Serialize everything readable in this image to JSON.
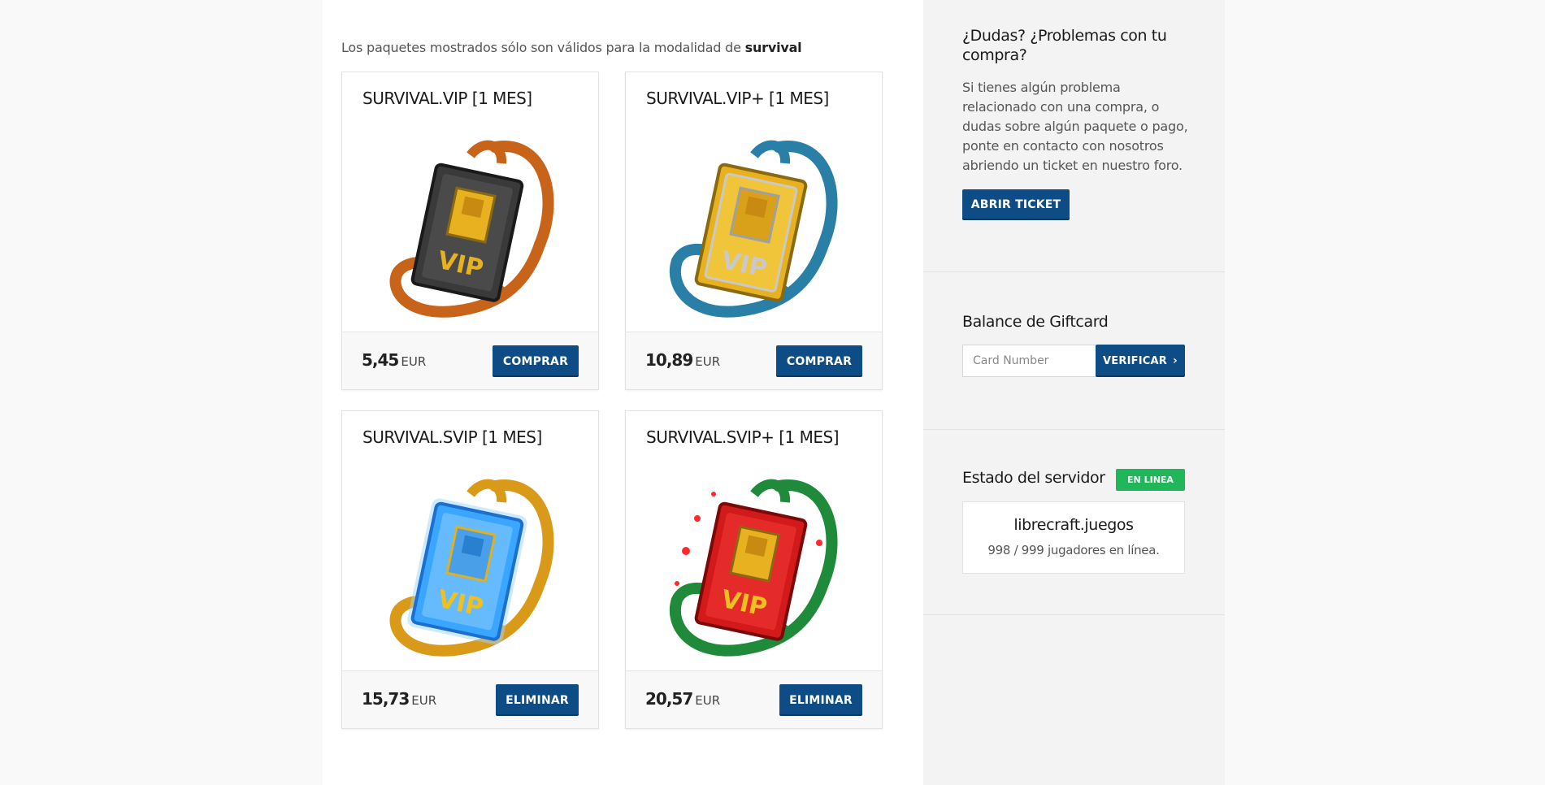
{
  "notice": {
    "prefix": "Los paquetes mostrados sólo son válidos para la modalidad de ",
    "mode": "survival"
  },
  "packages": [
    {
      "title": "SURVIVAL.VIP [1 MES]",
      "price": "5,45",
      "currency": "EUR",
      "button": "COMPRAR",
      "badge": {
        "tag": "#3a3a3a",
        "strap": "#c8631a"
      }
    },
    {
      "title": "SURVIVAL.VIP+ [1 MES]",
      "price": "10,89",
      "currency": "EUR",
      "button": "COMPRAR",
      "badge": {
        "tag": "#e8b120",
        "strap": "#2a7fa6"
      }
    },
    {
      "title": "SURVIVAL.SVIP [1 MES]",
      "price": "15,73",
      "currency": "EUR",
      "button": "ELIMINAR",
      "badge": {
        "tag": "#3aa6ff",
        "strap": "#d99a1a"
      }
    },
    {
      "title": "SURVIVAL.SVIP+ [1 MES]",
      "price": "20,57",
      "currency": "EUR",
      "button": "ELIMINAR",
      "badge": {
        "tag": "#d21a1a",
        "strap": "#1f8a3a"
      }
    }
  ],
  "sidebar": {
    "help": {
      "title": "¿Dudas? ¿Problemas con tu compra?",
      "text": "Si tienes algún problema relacionado con una compra, o dudas sobre algún paquete o pago, ponte en contacto con nosotros abriendo un ticket en nuestro foro.",
      "button": "ABRIR TICKET"
    },
    "giftcard": {
      "title": "Balance de Giftcard",
      "placeholder": "Card Number",
      "button": "VERIFICAR"
    },
    "server": {
      "title": "Estado del servidor",
      "status": "EN LINEA",
      "name": "librecraft.juegos",
      "players": "998 / 999 jugadores en línea."
    }
  },
  "colors": {
    "primary": "#0e4c85",
    "online": "#20b65a"
  }
}
